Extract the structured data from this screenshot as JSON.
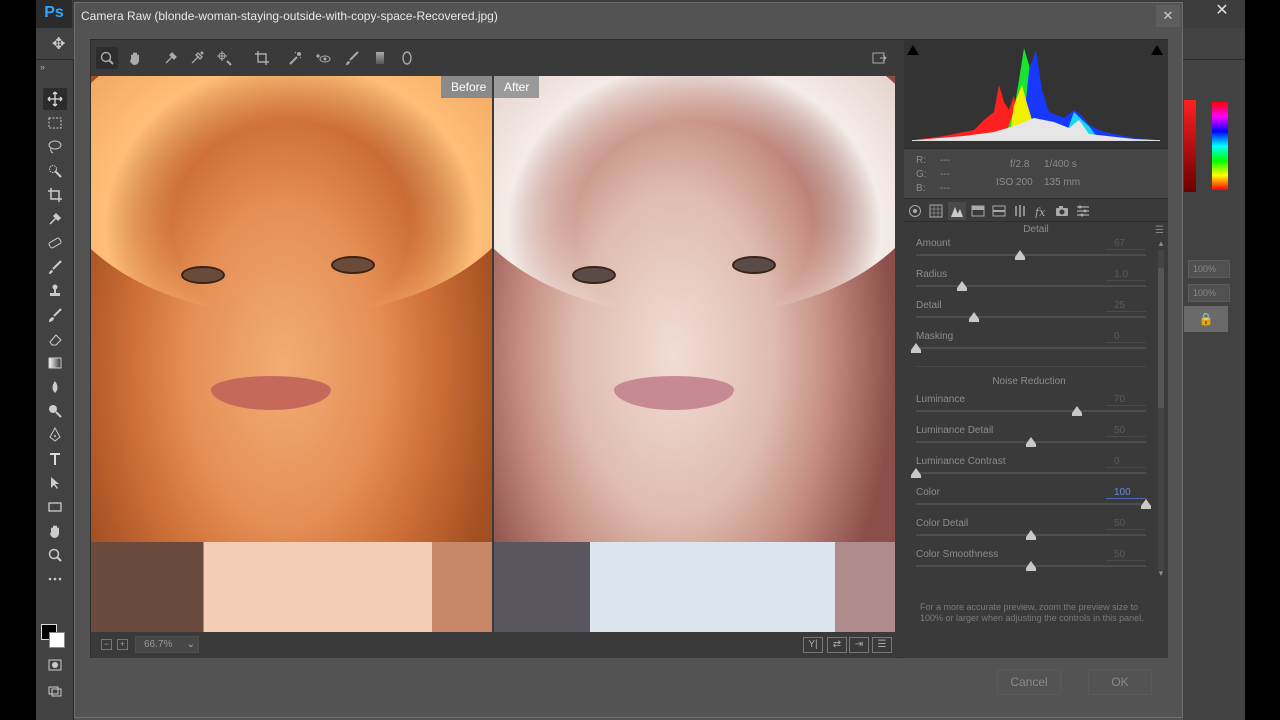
{
  "app": {
    "logo_text": "Ps",
    "close_glyph": "✕"
  },
  "dialog": {
    "title": "Camera Raw (blonde-woman-staying-outside-with-copy-space-Recovered.jpg)",
    "close_glyph": "✕",
    "ok_label": "OK",
    "cancel_label": "Cancel"
  },
  "cr_toolbar": {
    "tools": [
      "zoom-icon",
      "hand-icon",
      "white-balance-icon",
      "color-sampler-icon",
      "targeted-adjustment-icon",
      "crop-icon",
      "spot-removal-icon",
      "red-eye-icon",
      "adjustment-brush-icon",
      "graduated-filter-icon",
      "radial-filter-icon"
    ],
    "fullscreen_icon": "fullscreen-toggle-icon"
  },
  "preview": {
    "before_label": "Before",
    "after_label": "After",
    "zoom_level": "66.7%",
    "zoom_minus": "−",
    "zoom_plus": "+"
  },
  "info": {
    "r_label": "R:",
    "g_label": "G:",
    "b_label": "B:",
    "r_value": "---",
    "g_value": "---",
    "b_value": "---",
    "aperture": "f/2.8",
    "shutter": "1/400 s",
    "iso": "ISO 200",
    "focal_length": "135 mm"
  },
  "panel": {
    "title": "Detail",
    "sharpening": [
      {
        "label": "Amount",
        "value": "67",
        "fraction": 0.45
      },
      {
        "label": "Radius",
        "value": "1.0",
        "fraction": 0.2
      },
      {
        "label": "Detail",
        "value": "25",
        "fraction": 0.25
      },
      {
        "label": "Masking",
        "value": "0",
        "fraction": 0.0
      }
    ],
    "noise_title": "Noise Reduction",
    "noise": [
      {
        "label": "Luminance",
        "value": "70",
        "fraction": 0.7
      },
      {
        "label": "Luminance Detail",
        "value": "50",
        "fraction": 0.5
      },
      {
        "label": "Luminance Contrast",
        "value": "0",
        "fraction": 0.0
      },
      {
        "label": "Color",
        "value": "100",
        "fraction": 1.0
      },
      {
        "label": "Color Detail",
        "value": "50",
        "fraction": 0.5
      },
      {
        "label": "Color Smoothness",
        "value": "50",
        "fraction": 0.5
      }
    ],
    "tip": "For a more accurate preview, zoom the preview size to 100% or larger when adjusting the controls in this panel."
  },
  "ps_right": {
    "pct1": "100%",
    "pct2": "100%",
    "lock_glyph": "🔒"
  },
  "colors": {
    "dialog_bg": "#535353",
    "panel_bg": "#3a3a3a",
    "accent_focus": "#4a6ab0"
  }
}
